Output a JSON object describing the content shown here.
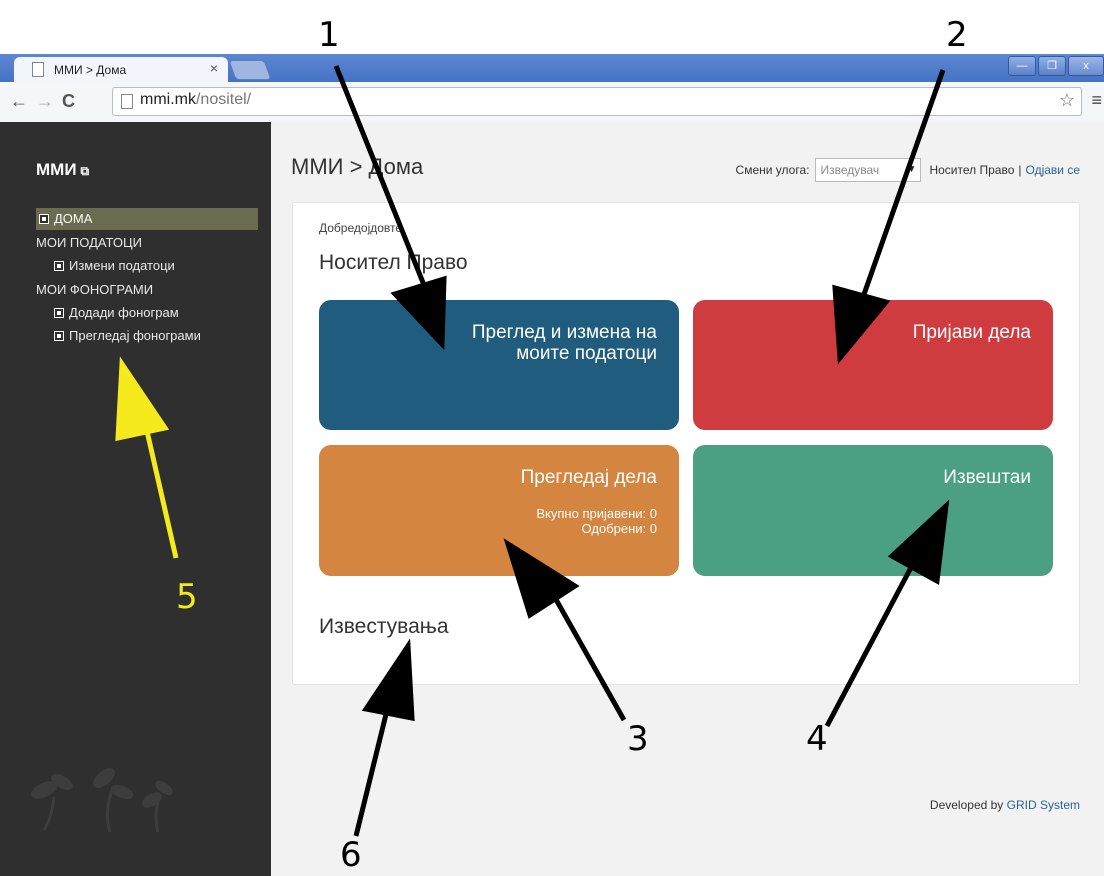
{
  "browser": {
    "tab_title": "ММИ > Дома",
    "tab_close": "×",
    "url_host": "mmi.mk",
    "url_path": "/nositel/",
    "win_minimize": "—",
    "win_restore": "❐",
    "win_close": "x"
  },
  "sidebar": {
    "brand": "ММИ",
    "items": [
      {
        "label": "ДОМА"
      },
      {
        "label": "МОИ ПОДАТОЦИ"
      },
      {
        "label": "Измени податоци"
      },
      {
        "label": "МОИ ФОНОГРАМИ"
      },
      {
        "label": "Додади фонограм"
      },
      {
        "label": "Прегледај фонограми"
      }
    ]
  },
  "header": {
    "breadcrumb": "ММИ > Дома",
    "role_label": "Смени улога:",
    "role_value": "Изведувач",
    "user_name": "Носител Право",
    "separator": "|",
    "logout": "Одјави се"
  },
  "panel": {
    "welcome": "Добредојдовте",
    "holder_name": "Носител Право",
    "notifications_title": "Известувања"
  },
  "tiles": {
    "profile": {
      "title": "Преглед и измена на моите податоци",
      "color": "#1f5c7d"
    },
    "register": {
      "title": "Пријави дела",
      "color": "#cf3c3f"
    },
    "works": {
      "title": "Прегледај дела",
      "total": "Вкупно пријавени: 0",
      "approved": "Одобрени: 0",
      "color": "#d4853f"
    },
    "reports": {
      "title": "Извештаи",
      "color": "#4b9f82"
    }
  },
  "footer": {
    "prefix": "Developed by",
    "company": "GRID System"
  },
  "annotations": {
    "n1": "1",
    "n2": "2",
    "n3": "3",
    "n4": "4",
    "n5": "5",
    "n6": "6",
    "arrow_color": "#000000",
    "highlight_color": "#f5ea1c"
  }
}
